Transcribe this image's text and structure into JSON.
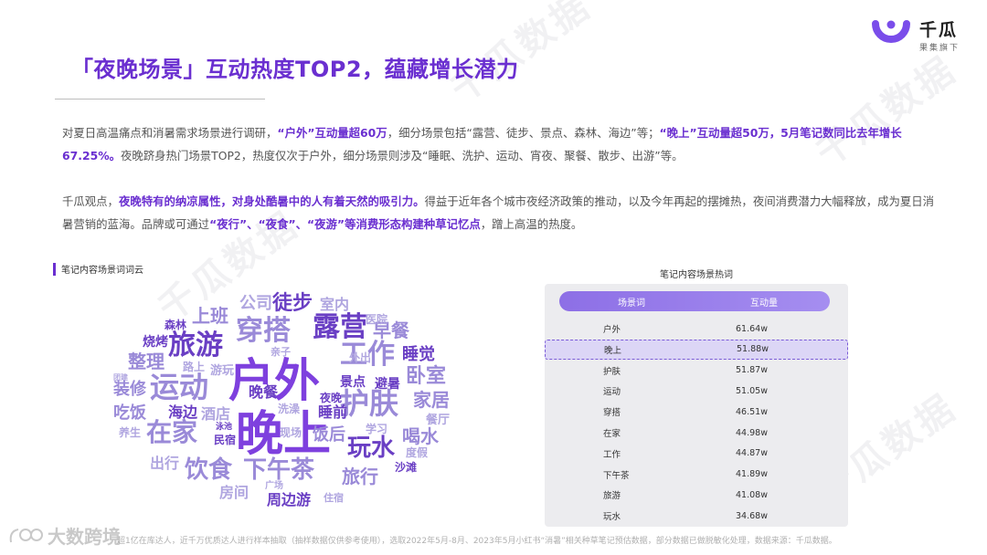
{
  "logo": {
    "name": "千瓜",
    "sub": "果集旗下",
    "brand_color": "#7a4dea"
  },
  "watermark": {
    "text": "千瓜数据"
  },
  "title": "「夜晚场景」互动热度TOP2，蕴藏增长潜力",
  "para1": {
    "s1": "对夏日高温痛点和消暑需求场景进行调研，",
    "h1": "“户外”互动量超60万",
    "s2": "，细分场景包括“露营、徒步、景点、森林、海边”等；",
    "h2": "“晚上”互动量超50万，5月笔记数同比去年增长67.25%。",
    "s3": "夜晚跻身热门场景TOP2，热度仅次于户外，细分场景则涉及“睡眠、洗护、运动、宵夜、聚餐、散步、出游”等。"
  },
  "para2": {
    "s1": "千瓜观点，",
    "h1": "夜晚特有的纳凉属性，对身处酷暑中的人有着天然的吸引力。",
    "s2": "得益于近年各个城市夜经济政策的推动，以及今年再起的摆摊热，夜间消费潜力大幅释放，成为夏日消暑营销的蓝海。品牌或可通过",
    "h2": "“夜行”、“夜食”、“夜游”等消费形态构建种草记忆点",
    "s3": "，蹭上高温的热度。"
  },
  "wordcloud": {
    "label": "笔记内容场景词词云",
    "words": [
      "户外",
      "晚上",
      "露营",
      "穿搭",
      "旅游",
      "工作",
      "护肤",
      "运动",
      "在家",
      "下午茶",
      "饮食",
      "玩水",
      "旅行",
      "卧室",
      "家居",
      "徒步",
      "公司",
      "上班",
      "早餐",
      "睡觉",
      "整理",
      "装修",
      "吃饭",
      "海边",
      "酒店",
      "喝水",
      "周边游",
      "森林",
      "烧烤",
      "室内",
      "医院",
      "亲子",
      "外出",
      "景点",
      "避暑",
      "晚餐",
      "夜晚",
      "睡前",
      "洗澡",
      "饭后",
      "学习",
      "现场",
      "民宿",
      "泳池",
      "养生",
      "出行",
      "房间",
      "广场",
      "住宿",
      "沙滩",
      "度假",
      "餐厅",
      "路上",
      "游玩",
      "团建"
    ]
  },
  "table": {
    "caption": "笔记内容场景热词",
    "headers": [
      "场景词",
      "互动量"
    ],
    "rows": [
      [
        "户外",
        "61.64w"
      ],
      [
        "晚上",
        "51.88w"
      ],
      [
        "护肤",
        "51.87w"
      ],
      [
        "运动",
        "51.05w"
      ],
      [
        "穿搭",
        "46.51w"
      ],
      [
        "在家",
        "44.98w"
      ],
      [
        "工作",
        "44.87w"
      ],
      [
        "下午茶",
        "41.89w"
      ],
      [
        "旅游",
        "41.08w"
      ],
      [
        "玩水",
        "34.68w"
      ]
    ]
  },
  "footer": "超1亿在库达人，近千万优质达人进行样本抽取（抽样数据仅供参考使用），选取2022年5月-8月、2023年5月小红书“消暑”相关种草笔记预估数据，部分数据已做脱敏化处理，数据来源：千瓜数据。",
  "corner": "大数跨境"
}
